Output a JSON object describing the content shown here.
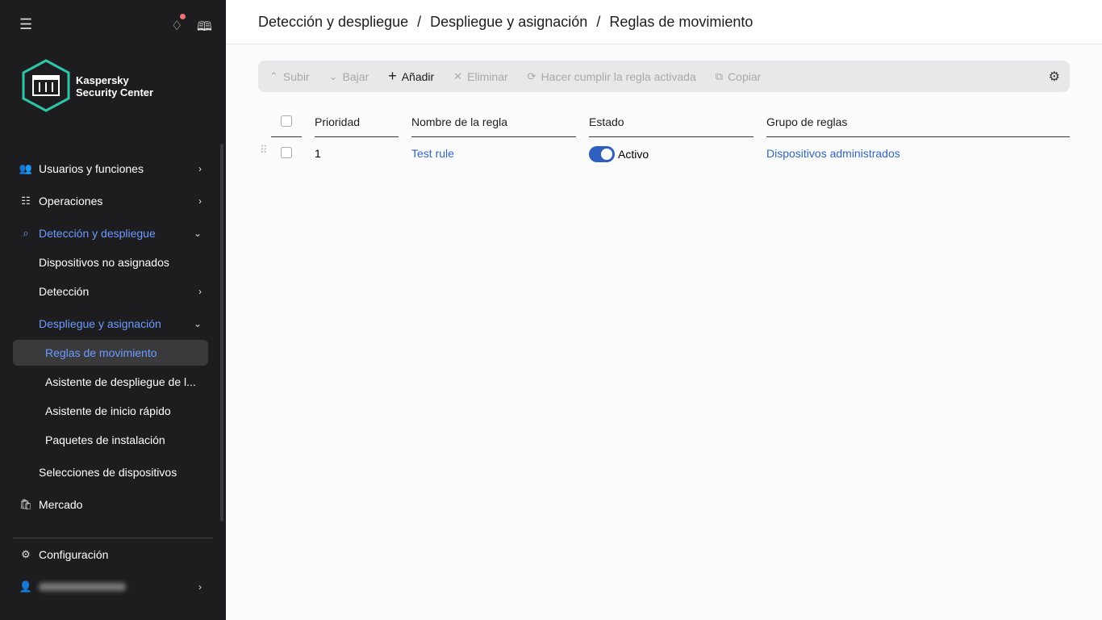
{
  "app": {
    "brand_line1": "Kaspersky",
    "brand_line2": "Security Center"
  },
  "sidebar": {
    "items": [
      {
        "label": "Usuarios y funciones"
      },
      {
        "label": "Operaciones"
      },
      {
        "label": "Detección y despliegue"
      },
      {
        "label": "Dispositivos no asignados"
      },
      {
        "label": "Detección"
      },
      {
        "label": "Despliegue y asignación"
      },
      {
        "label": "Reglas de movimiento"
      },
      {
        "label": "Asistente de despliegue de l..."
      },
      {
        "label": "Asistente de inicio rápido"
      },
      {
        "label": "Paquetes de instalación"
      },
      {
        "label": "Selecciones de dispositivos"
      },
      {
        "label": "Mercado"
      },
      {
        "label": "Configuración"
      }
    ]
  },
  "breadcrumb": {
    "items": [
      "Detección y despliegue",
      "Despliegue y asignación",
      "Reglas de movimiento"
    ],
    "sep": "/"
  },
  "toolbar": {
    "up": "Subir",
    "down": "Bajar",
    "add": "Añadir",
    "delete": "Eliminar",
    "enforce": "Hacer cumplir la regla activada",
    "copy": "Copiar"
  },
  "table": {
    "headers": [
      "Prioridad",
      "Nombre de la regla",
      "Estado",
      "Grupo de reglas"
    ],
    "rows": [
      {
        "priority": "1",
        "name": "Test rule",
        "status": "Activo",
        "group": "Dispositivos administrados",
        "enabled": true
      }
    ]
  },
  "colors": {
    "accent": "#2f65c9",
    "sidebar": "#1d1d1f",
    "logo": "#2ec4a9"
  }
}
